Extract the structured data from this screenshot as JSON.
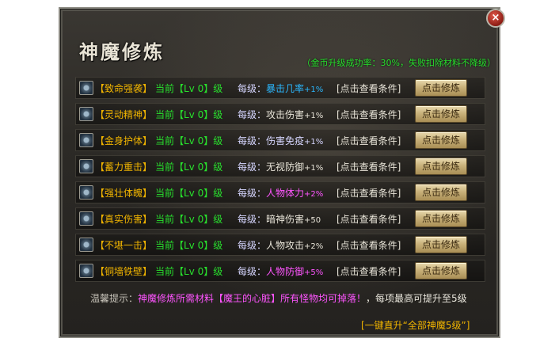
{
  "window": {
    "title": "神魔修炼",
    "close_glyph": "×"
  },
  "notice": "（金币升级成功率：30%，失败扣除材料不降级）",
  "rows": [
    {
      "name": "【致命强袭】",
      "level": "当前【Lv 0】级",
      "each": "每级：",
      "effect": "暴击几率",
      "value": "+1%",
      "effect_color": "#2bb8ff",
      "condition": "[点击查看条件]",
      "button": "点击修炼"
    },
    {
      "name": "【灵动精神】",
      "level": "当前【Lv 0】级",
      "each": "每级：",
      "effect": "攻击伤害",
      "value": "+1%",
      "effect_color": "#e8e4d8",
      "condition": "[点击查看条件]",
      "button": "点击修炼"
    },
    {
      "name": "【金身护体】",
      "level": "当前【Lv 0】级",
      "each": "每级：",
      "effect": "伤害免疫",
      "value": "+1%",
      "effect_color": "#d6d6ff",
      "condition": "[点击查看条件]",
      "button": "点击修炼"
    },
    {
      "name": "【蓄力重击】",
      "level": "当前【Lv 0】级",
      "each": "每级：",
      "effect": "无视防御",
      "value": "+1%",
      "effect_color": "#e8e4d8",
      "condition": "[点击查看条件]",
      "button": "点击修炼"
    },
    {
      "name": "【强壮体魄】",
      "level": "当前【Lv 0】级",
      "each": "每级：",
      "effect": "人物体力",
      "value": "+2%",
      "effect_color": "#ff55ff",
      "condition": "[点击查看条件]",
      "button": "点击修炼"
    },
    {
      "name": "【真实伤害】",
      "level": "当前【Lv 0】级",
      "each": "每级：",
      "effect": "暗神伤害",
      "value": "+50",
      "effect_color": "#e8e4d8",
      "condition": "[点击查看条件]",
      "button": "点击修炼"
    },
    {
      "name": "【不堪一击】",
      "level": "当前【Lv 0】级",
      "each": "每级：",
      "effect": "人物攻击",
      "value": "+2%",
      "effect_color": "#e8e4d8",
      "condition": "[点击查看条件]",
      "button": "点击修炼"
    },
    {
      "name": "【铜墙铁壁】",
      "level": "当前【Lv 0】级",
      "each": "每级：",
      "effect": "人物防御",
      "value": "+5%",
      "effect_color": "#ff55ff",
      "condition": "[点击查看条件]",
      "button": "点击修炼"
    }
  ],
  "tip": {
    "prefix": "温馨提示：",
    "text": "神魔修炼所需材料【魔王的心脏】所有怪物均可掉落！",
    "suffix": "，每项最高可提升至5级"
  },
  "one_key": "[一键直升“全部神魔5级”]",
  "colors": {
    "name": "#f0b400",
    "level": "#28e02d",
    "each_label": "#d6d6ff",
    "button_bg": "#c9b27b"
  }
}
